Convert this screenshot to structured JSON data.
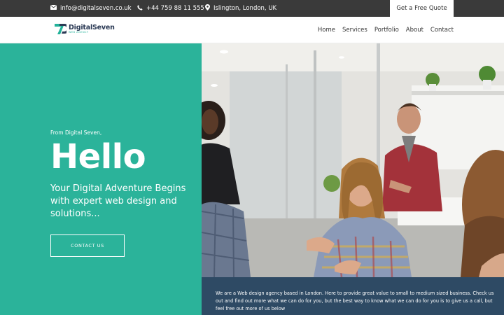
{
  "topbar": {
    "email": "info@digitalseven.co.uk",
    "phone": "+44 759 88 11 555",
    "address": "Islington, London, UK",
    "quote_label": "Get a Free Quote",
    "icons": [
      "envelope-icon",
      "phone-icon",
      "map-pin-icon"
    ]
  },
  "header": {
    "logo_main": "DigitalSeven",
    "logo_sub": "WEB AGENCY",
    "nav": [
      "Home",
      "Services",
      "Portfolio",
      "About",
      "Contact"
    ]
  },
  "hero": {
    "intro": "From Digital Seven,",
    "title": "Hello",
    "subtitle": "Your Digital Adventure Begins with expert web design and solutions...",
    "cta_label": "CONTACT US"
  },
  "info": {
    "text": "We are a Web design agency based in London. Here to provide great value to small to medium sized business. Check us out and find out more what we can do for you, but the best way to know what we can do for you is to give us a call, but feel  free out more of us below"
  },
  "colors": {
    "topbar": "#3a3a3a",
    "accent": "#2bb39a",
    "navy": "#2e4a64",
    "logo_dark": "#2b3a55"
  }
}
